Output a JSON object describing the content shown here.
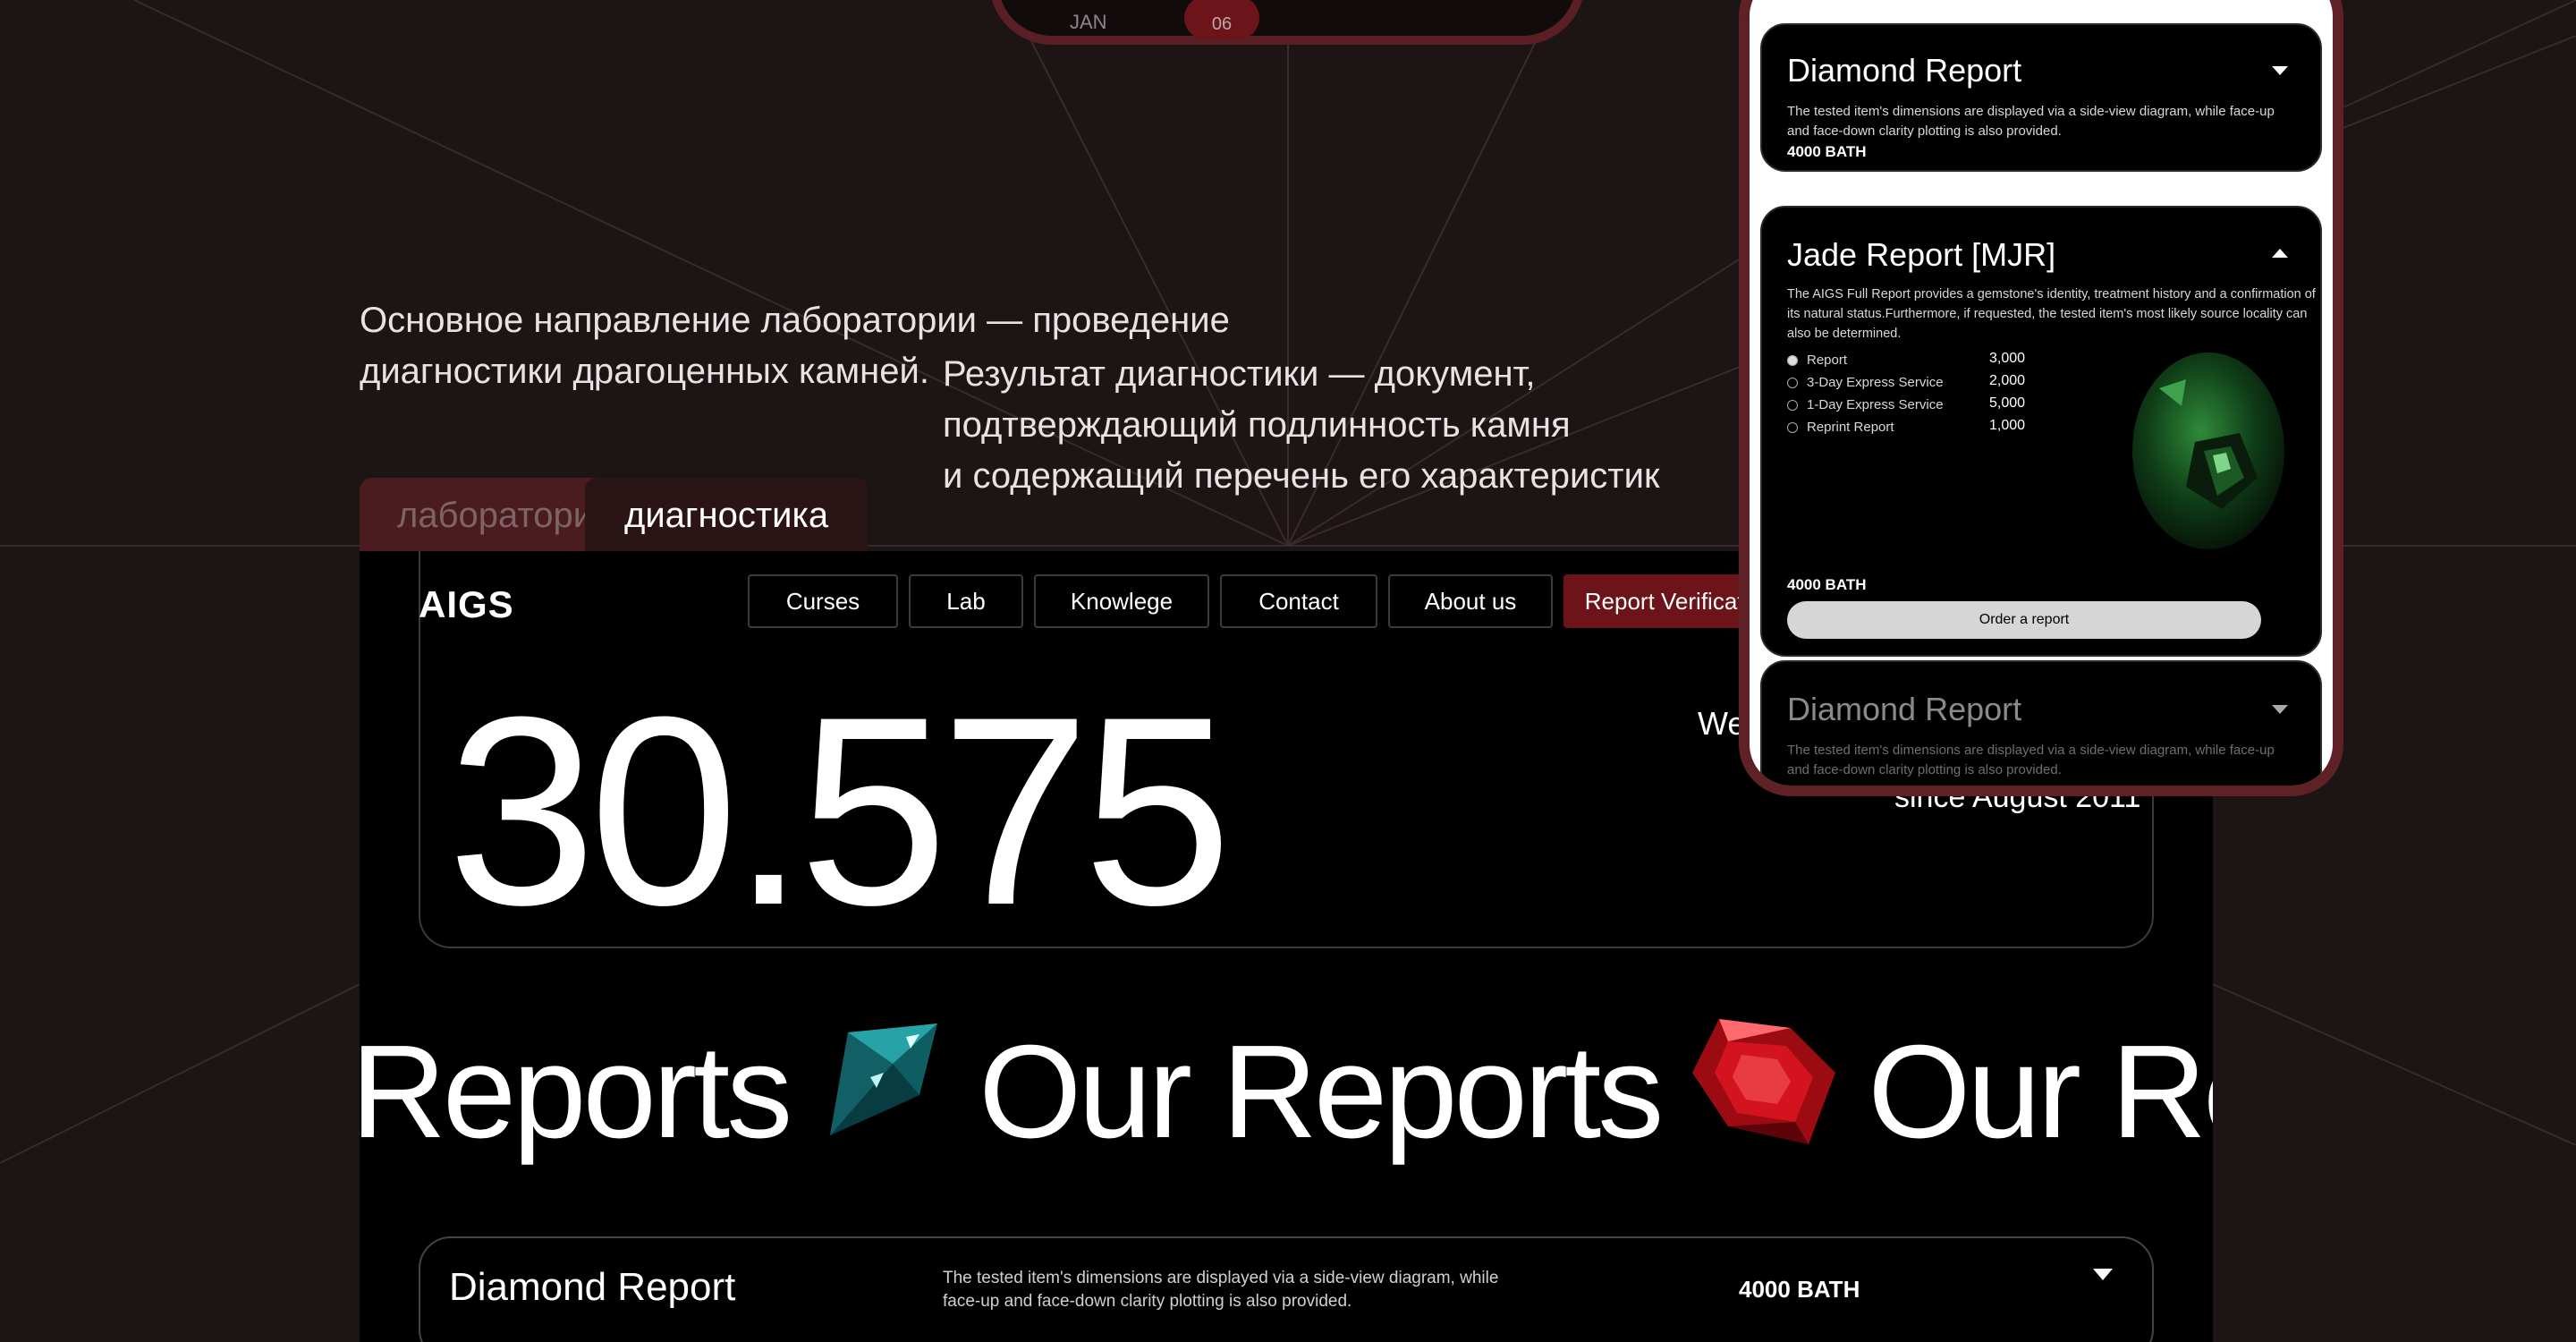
{
  "top_phone": {
    "month": "JAN",
    "day": "06"
  },
  "headline": {
    "part1_line1": "Основное направление лаборатории — проведение",
    "part1_line2": "диагностики драгоценных камней.",
    "part2_line1": "Результат диагностики — документ,",
    "part2_line2": "подтверждающий подлинность камня",
    "part2_line3": "и содержащий перечень его характеристик"
  },
  "tabs": [
    {
      "label": "лаборатория"
    },
    {
      "label": "диагностика"
    }
  ],
  "site": {
    "logo": "AIGS",
    "nav": [
      {
        "label": "Curses"
      },
      {
        "label": "Lab"
      },
      {
        "label": "Knowlege"
      },
      {
        "label": "Contact"
      },
      {
        "label": "About us"
      },
      {
        "label": "Report Verification"
      }
    ],
    "counter": "30.575",
    "counter_caption": "We",
    "since": "since August 2011",
    "marquee_text": "Our Reports",
    "marquee_first_fragment": "Reports",
    "marquee_last_fragment": "Our Rep",
    "report_row": {
      "title": "Diamond Report",
      "desc": "The tested item's dimensions are displayed via a side-view diagram, while face-up and face-down clarity plotting is also provided.",
      "price": "4000 BATH"
    }
  },
  "phone": {
    "card1": {
      "title": "Diamond Report",
      "desc": "The tested item's dimensions are displayed via a side-view diagram, while face-up and face-down clarity plotting is also provided.",
      "price": "4000 BATH"
    },
    "card2": {
      "title": "Jade Report  [MJR]",
      "desc": "The AIGS Full Report provides a gemstone's identity, treatment history and a confirmation of its natural status.Furthermore, if requested, the tested item's most likely source locality can also be determined.",
      "options": [
        {
          "label": "Report",
          "value": "3,000",
          "selected": true
        },
        {
          "label": "3-Day Express Service",
          "value": "2,000",
          "selected": false
        },
        {
          "label": "1-Day Express Service",
          "value": "5,000",
          "selected": false
        },
        {
          "label": "Reprint Report",
          "value": "1,000",
          "selected": false
        }
      ],
      "price": "4000 BATH",
      "button": "Order a report"
    },
    "card3": {
      "title": "Diamond Report",
      "desc": "The tested item's dimensions are displayed via a side-view diagram, while face-up and face-down clarity plotting is also provided."
    }
  },
  "colors": {
    "background": "#1c1415",
    "accent": "#6d141a",
    "phone_frame": "#5e2126"
  }
}
